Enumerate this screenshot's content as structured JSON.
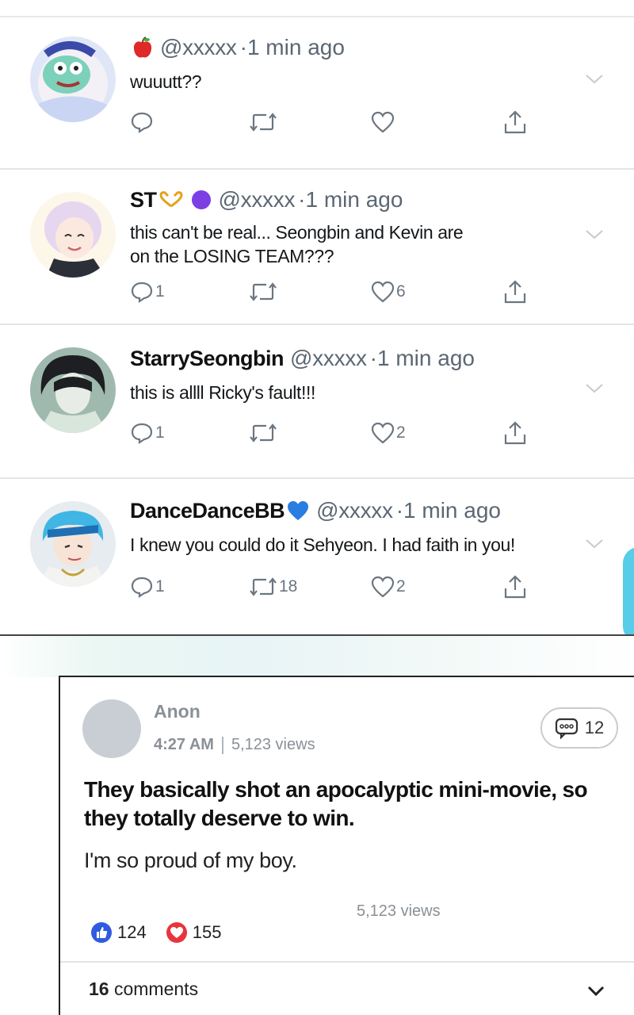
{
  "tweets": [
    {
      "name": "",
      "badge": "apple",
      "handle": "@xxxxx",
      "time": "·1 min ago",
      "text": [
        "wuuutt??"
      ],
      "replies": "",
      "retweets": "",
      "likes": ""
    },
    {
      "name": "ST",
      "badge": "hands-heart purple-circle",
      "handle": "@xxxxx",
      "time": "·1 min ago",
      "text": [
        "this can't be real... Seongbin and Kevin are",
        "on the LOSING TEAM???"
      ],
      "replies": "1",
      "retweets": "",
      "likes": "6"
    },
    {
      "name": "StarrySeongbin",
      "badge": "",
      "handle": "@xxxxx",
      "time": "·1 min ago",
      "text": [
        "this is allll Ricky's fault!!!"
      ],
      "replies": "1",
      "retweets": "",
      "likes": "2"
    },
    {
      "name": "DanceDanceBB",
      "badge": "blue-heart",
      "handle": "@xxxxx",
      "time": "·1 min ago",
      "text": [
        "I knew you could do it Sehyeon. I had faith in you!"
      ],
      "replies": "1",
      "retweets": "18",
      "likes": "2"
    }
  ],
  "post": {
    "author": "Anon",
    "time": "4:27 AM",
    "views_meta": "5,123 views",
    "comment_count": "12",
    "headline": "They basically shot an apocalyptic mini-movie, so they totally deserve to win.",
    "body": "I'm so proud of my boy.",
    "views": "5,123 views",
    "likes": "124",
    "hearts": "155",
    "comments_number": "16",
    "comments_word": "comments"
  },
  "icons": {
    "reply": "reply-icon",
    "retweet": "retweet-icon",
    "like": "like-icon",
    "share": "share-icon",
    "more": "chevron-down-icon"
  },
  "colors": {
    "text": "#14171a",
    "muted": "#5b6773",
    "icon": "#6b7680",
    "like_blue": "#2f5be0",
    "heart_red": "#e8343c",
    "purple_badge": "#7b3fe4",
    "blue_heart": "#2a7de1"
  }
}
